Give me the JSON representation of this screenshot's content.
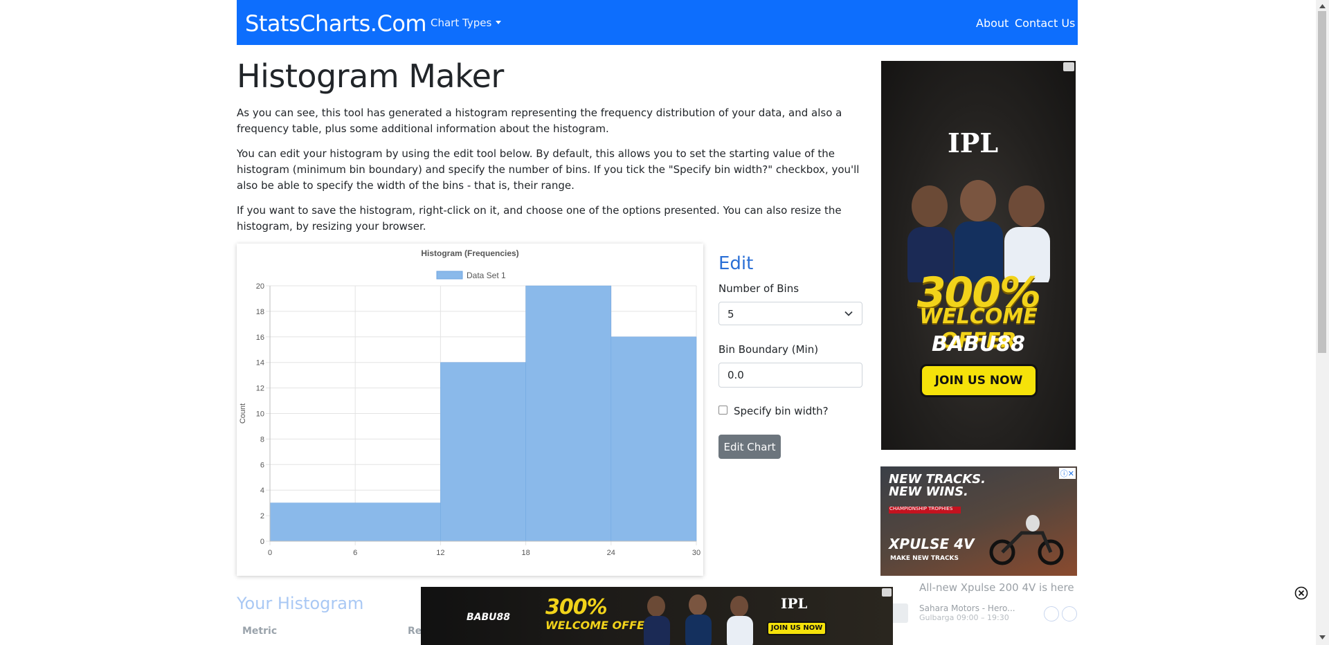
{
  "navbar": {
    "brand": "StatsCharts.Com",
    "chart_types": "Chart Types",
    "about": "About",
    "contact": "Contact Us",
    "color": "#0d6efd"
  },
  "page": {
    "title": "Histogram Maker",
    "paragraphs": [
      "As you can see, this tool has generated a histogram representing the frequency distribution of your data, and also a frequency table, plus some additional information about the histogram.",
      "You can edit your histogram by using the edit tool below. By default, this allows you to set the starting value of the histogram (minimum bin boundary) and specify the number of bins. If you tick the \"Specify bin width?\" checkbox, you'll also be able to specify the width of the bins - that is, their range.",
      "If you want to save the histogram, right-click on it, and choose one of the options presented. You can also resize the histogram, by resizing your browser."
    ]
  },
  "chart_data": {
    "type": "bar",
    "title": "Histogram (Frequencies)",
    "legend": "Data Set 1",
    "legend_position": "top",
    "xlabel": "",
    "ylabel": "Count",
    "bins": [
      [
        0,
        12,
        3
      ],
      [
        12,
        18,
        14
      ],
      [
        18,
        24,
        20
      ],
      [
        24,
        30,
        16
      ]
    ],
    "x_ticks": [
      0,
      6,
      12,
      18,
      24,
      30
    ],
    "y_ticks": [
      0,
      2,
      4,
      6,
      8,
      10,
      12,
      14,
      16,
      18,
      20
    ],
    "xlim": [
      0,
      30
    ],
    "ylim": [
      0,
      20
    ],
    "grid": true,
    "bar_color": "#8ab9ea"
  },
  "edit": {
    "heading": "Edit",
    "bins_label": "Number of Bins",
    "bins_value": "5",
    "boundary_label": "Bin Boundary (Min)",
    "boundary_value": "0.0",
    "checkbox_label": "Specify bin width?",
    "button": "Edit Chart"
  },
  "results": {
    "title": "Your Histogram",
    "col_metric": "Metric",
    "col_result": "Re"
  },
  "ads": {
    "side": {
      "logo": "IPL",
      "offer_pct": "300%",
      "offer_text": "WELCOME OFFER",
      "brand": "BABU88",
      "cta": "JOIN US NOW"
    },
    "bike": {
      "line1": "NEW TRACKS.",
      "line2": "NEW WINS.",
      "strip": "CHAMPIONSHIP TROPHIES",
      "model": "XPULSE 4V",
      "tagline": "MAKE NEW TRACKS",
      "headline": "All-new Xpulse 200 4V is here",
      "merchant": "Sahara Motors - Hero...",
      "location": "Gulbarga 09:00 – 19:30"
    },
    "bottom": {
      "brand": "BABU88",
      "offer_pct": "300%",
      "offer_text": "WELCOME OFFER",
      "logo": "IPL",
      "cta": "JOIN US NOW"
    }
  }
}
